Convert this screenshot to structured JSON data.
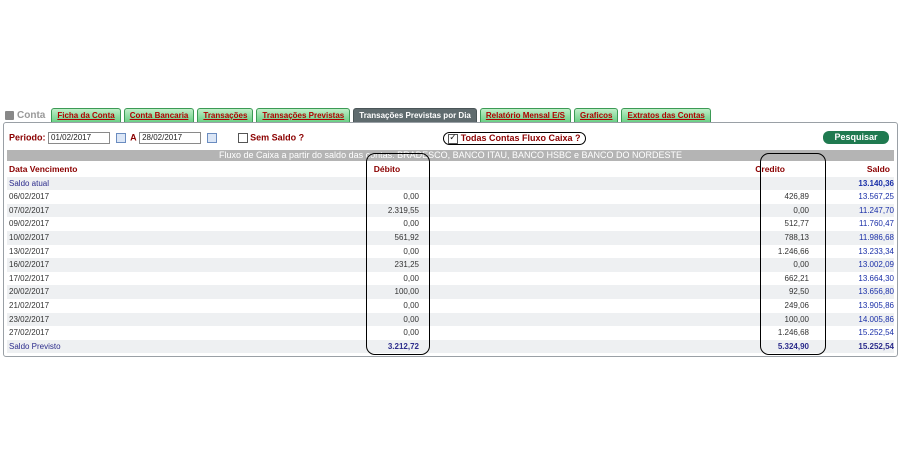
{
  "tabs": {
    "home": "Conta",
    "items": [
      "Ficha da Conta",
      "Conta Bancaria",
      "Transações",
      "Transações Previstas",
      "Transações Previstas por Dia",
      "Relatório Mensal E/S",
      "Graficos",
      "Extratos das Contas"
    ],
    "active_index": 4
  },
  "filter": {
    "periodo_label": "Periodo:",
    "data_inicio": "01/02/2017",
    "a_label": "A",
    "data_fim": "28/02/2017",
    "sem_saldo_label": "Sem Saldo ?",
    "sem_saldo_checked": false,
    "todas_contas_label": "Todas Contas Fluxo Caixa ?",
    "todas_contas_checked": true,
    "pesquisar_label": "Pesquisar"
  },
  "banner": "Fluxo de Caixa a partir do saldo das contas: BRADESCO, BANCO ITAU, BANCO HSBC e BANCO DO NORDESTE",
  "table": {
    "headers": [
      "Data Vencimento",
      "Débito",
      "Credito",
      "Saldo"
    ],
    "saldo_atual_label": "Saldo atual",
    "saldo_atual_value": "13.140,36",
    "rows": [
      [
        "06/02/2017",
        "0,00",
        "426,89",
        "13.567,25"
      ],
      [
        "07/02/2017",
        "2.319,55",
        "0,00",
        "11.247,70"
      ],
      [
        "09/02/2017",
        "0,00",
        "512,77",
        "11.760,47"
      ],
      [
        "10/02/2017",
        "561,92",
        "788,13",
        "11.986,68"
      ],
      [
        "13/02/2017",
        "0,00",
        "1.246,66",
        "13.233,34"
      ],
      [
        "16/02/2017",
        "231,25",
        "0,00",
        "13.002,09"
      ],
      [
        "17/02/2017",
        "0,00",
        "662,21",
        "13.664,30"
      ],
      [
        "20/02/2017",
        "100,00",
        "92,50",
        "13.656,80"
      ],
      [
        "21/02/2017",
        "0,00",
        "249,06",
        "13.905,86"
      ],
      [
        "23/02/2017",
        "0,00",
        "100,00",
        "14.005,86"
      ],
      [
        "27/02/2017",
        "0,00",
        "1.246,68",
        "15.252,54"
      ]
    ],
    "footer": [
      "Saldo Previsto",
      "3.212,72",
      "5.324,90",
      "15.252,54"
    ]
  },
  "colors": {
    "tab_green": "#6bcf86",
    "tab_active": "#5f6b6e",
    "header_red": "#8b0000",
    "saldo_blue": "#1a2fa8",
    "button_green": "#1f7a50"
  }
}
